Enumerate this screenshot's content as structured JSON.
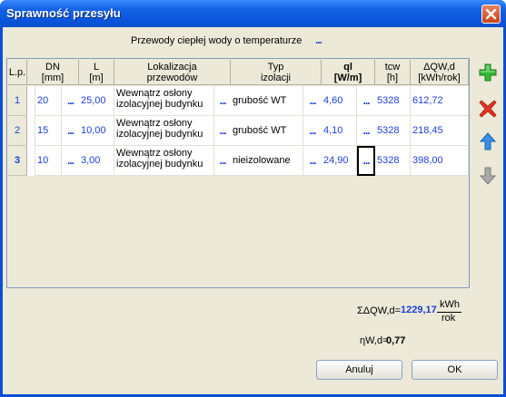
{
  "window": {
    "title": "Sprawność przesyłu"
  },
  "subtitle": {
    "text": "Przewody ciepłej wody o temperaturze",
    "dots": "..."
  },
  "table": {
    "headers": {
      "lp": "L.p.",
      "dn": "DN\n[mm]",
      "l": "L\n[m]",
      "lok": "Lokalizacja\nprzewodów",
      "typ": "Typ\nizolacji",
      "ql": "ql\n[W/m]",
      "tcw": "tcw\n[h]",
      "dq": "ΔQW,d\n[kWh/rok]"
    },
    "dots": "...",
    "rows": [
      {
        "lp": "1",
        "dn": "20",
        "l": "25,00",
        "lok": "Wewnątrz osłony izolacyjnej budynku",
        "typ": "grubość WT",
        "ql": "4,60",
        "tcw": "5328",
        "dq": "612,72"
      },
      {
        "lp": "2",
        "dn": "15",
        "l": "10,00",
        "lok": "Wewnątrz osłony izolacyjnej budynku",
        "typ": "grubość WT",
        "ql": "4,10",
        "tcw": "5328",
        "dq": "218,45"
      },
      {
        "lp": "3",
        "dn": "10",
        "l": "3,00",
        "lok": "Wewnątrz osłony izolacyjnej budynku",
        "typ": "nieizolowane",
        "ql": "24,90",
        "tcw": "5328",
        "dq": "398,00"
      }
    ]
  },
  "side_buttons": {
    "add": "plus-icon",
    "delete": "x-icon",
    "up": "arrow-up-icon",
    "down": "arrow-down-icon"
  },
  "summary": {
    "sum_label": "ΣΔQW,d=",
    "sum_value": "1229,17",
    "unit_num": "kWh",
    "unit_den": "rok",
    "eta_label": "ηW,d=",
    "eta_value": "0,77"
  },
  "buttons": {
    "cancel": "Anuluj",
    "ok": "OK"
  },
  "colors": {
    "accent": "#1c3fd6",
    "title_bar": "#0a56de",
    "add_green": "#2ea32e",
    "delete_red": "#d8261a"
  }
}
